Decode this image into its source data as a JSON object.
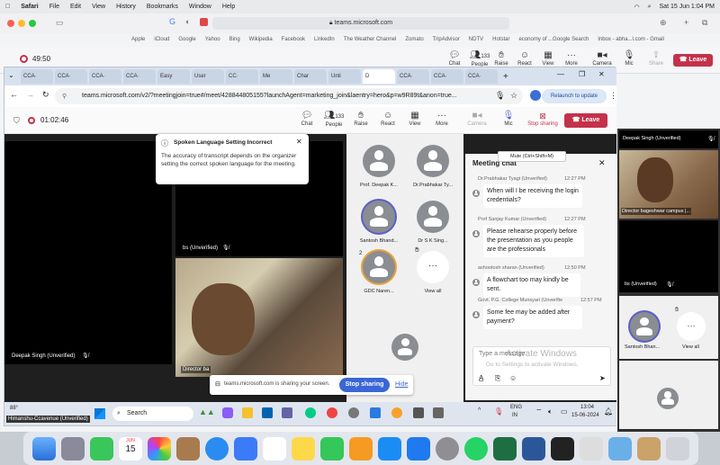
{
  "menubar": {
    "items": [
      "Safari",
      "File",
      "Edit",
      "View",
      "History",
      "Bookmarks",
      "Window",
      "Help"
    ],
    "datetime": "Sat 15 Jun  1:04 PM"
  },
  "safari": {
    "address": "teams.microsoft.com",
    "favorites": [
      "Apple",
      "iCloud",
      "Google",
      "Yahoo",
      "Bing",
      "Wikipedia",
      "Facebook",
      "LinkedIn",
      "The Weather Channel",
      "Zomato",
      "TripAdvisor",
      "NDTV",
      "Hotstar",
      "economy of ...Google Search",
      "Inbox - abha...l.com - Gmail"
    ]
  },
  "outer_teams": {
    "timer": "49:50",
    "buttons": [
      {
        "label": "Chat"
      },
      {
        "label": "People",
        "count": "133"
      },
      {
        "label": "Raise"
      },
      {
        "label": "React"
      },
      {
        "label": "View"
      },
      {
        "label": "More"
      },
      {
        "label": "Camera"
      },
      {
        "label": "Mic"
      },
      {
        "label": "Share"
      }
    ],
    "leave": "Leave"
  },
  "chrome": {
    "tabs": [
      "CCA·",
      "CCA·",
      "CCA·",
      "CCA·",
      "Easy",
      "User",
      "CC·",
      "Me",
      "Char",
      "Unti",
      "D",
      "CCA·",
      "CCA·",
      "CCA·"
    ],
    "url": "teams.microsoft.com/v2/?meetingjoin=true#/meet/428844805155?launchAgent=marketing_join&laentry=hero&p=w9R89t&anon=true...",
    "relaunch": "Relaunch to update"
  },
  "inner_teams": {
    "timer": "01:02:46",
    "buttons": [
      {
        "label": "Chat"
      },
      {
        "label": "People",
        "count": "133"
      },
      {
        "label": "Raise"
      },
      {
        "label": "React"
      },
      {
        "label": "View"
      },
      {
        "label": "More"
      },
      {
        "label": "Camera"
      },
      {
        "label": "Mic"
      },
      {
        "label": "Stop sharing"
      }
    ],
    "leave": "Leave",
    "mute_tooltip": "Mute (Ctrl+Shift+M)"
  },
  "notice": {
    "title": "Spoken Language Setting Incorrect",
    "body": "The accuracy of transcript depends on the organizer setting the correct spoken language for the meeting."
  },
  "tiles": {
    "deepak": "Deepak Singh (Unverified)",
    "bs": "bs (Unverified)",
    "director": "Director ba"
  },
  "grid": [
    {
      "name": "Prof. Deepak K..."
    },
    {
      "name": "Dr.Prabhakar Ty..."
    },
    {
      "name": "Santosh Bhand..."
    },
    {
      "name": "Dr S K Sing..."
    },
    {
      "name": "GDC Naren...",
      "badge": "2"
    },
    {
      "name": "View all"
    }
  ],
  "chat": {
    "title": "Meeting chat",
    "messages": [
      {
        "sender": "Dr.Prabhakar Tyagi (Unverified)",
        "time": "12:27 PM",
        "text": "When will I be receiving the login credentials?"
      },
      {
        "sender": "Prof Sanjay Kumar (Unverified)",
        "time": "12:27 PM",
        "text": "Please rehearse properly before the presentation as you people are the professionals"
      },
      {
        "sender": "ashootosh sharan (Unverified)",
        "time": "12:50 PM",
        "text": "A flowchart too may kindly be sent."
      },
      {
        "sender": "Govt. P.G. College Munsyari (Unverifie",
        "time": "12:57 PM",
        "text": "Some fee may be added after payment?"
      }
    ],
    "input_placeholder": "Type a message",
    "watermark_1": "Activate Windows",
    "watermark_2": "Go to Settings to activate Windows."
  },
  "share_bar": {
    "text": "teams.microsoft.com is sharing your screen.",
    "stop": "Stop sharing",
    "hide": "Hide"
  },
  "taskbar": {
    "weather": "88°",
    "user": "Himanshu-Ccavenue (Unverified)",
    "search": "Search",
    "lang_1": "ENG",
    "lang_2": "IN",
    "time": "13:04",
    "date": "15-06-2024"
  },
  "right_panel": {
    "tile1": "Deepak Singh (Unverified)",
    "tile2": "Director bageshwar campus |...",
    "tile3": "bs (Unverified)",
    "avatar_name": "Santosh Bhan...",
    "view_all": "View all"
  },
  "dock": {
    "calendar_month": "JUN",
    "calendar_day": "15"
  },
  "colors": {
    "leave": "#c4314b",
    "stop_sharing": "#3a67d6",
    "teams_purple": "#5b5fc7"
  }
}
